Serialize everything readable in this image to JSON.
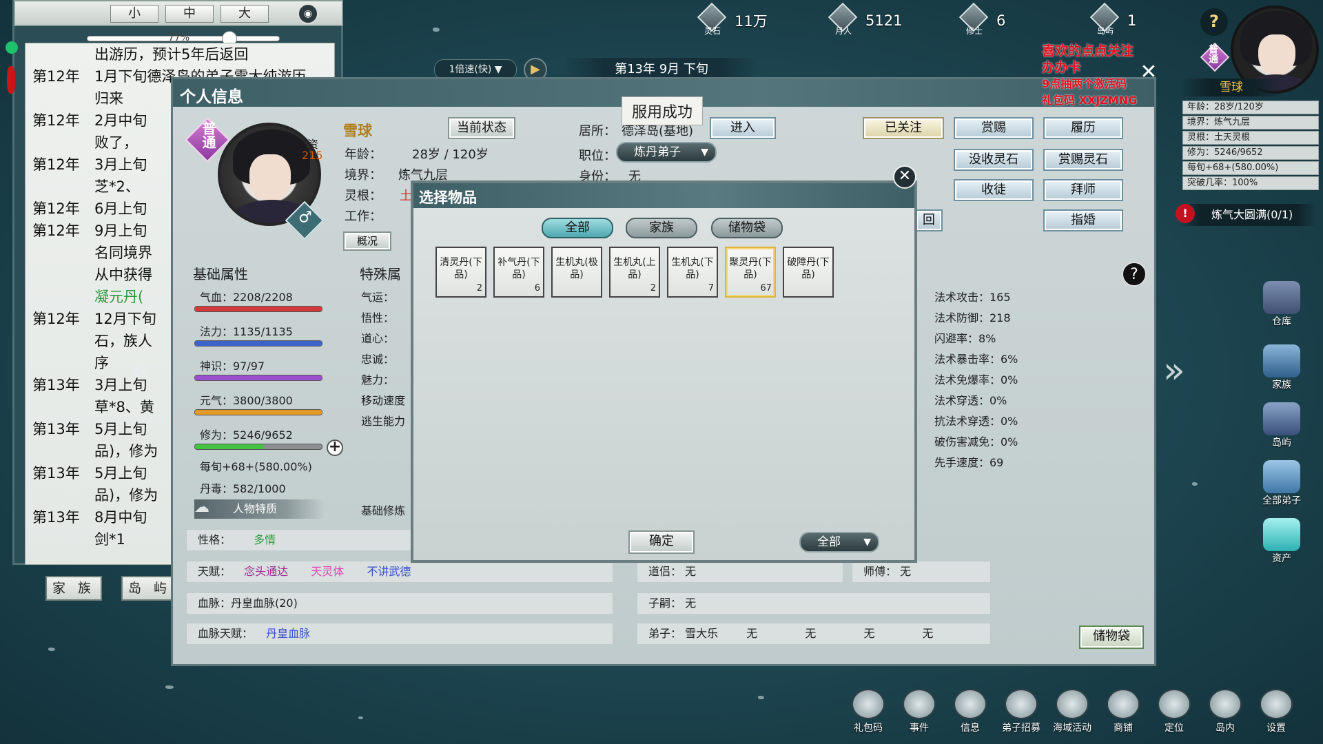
{
  "top_resources": [
    {
      "label": "灵石",
      "value": "11万"
    },
    {
      "label": "月人",
      "value": "5121"
    },
    {
      "label": "修士",
      "value": "6"
    },
    {
      "label": "岛屿",
      "value": "1"
    }
  ],
  "log": {
    "size_buttons": [
      "小",
      "中",
      "大"
    ],
    "zoom_pct": "77%",
    "entries": [
      {
        "year": "",
        "text": "出游历，预计5年后返回"
      },
      {
        "year": "第12年",
        "text": "1月下旬德泽岛的弟子雪大纯游历\n归来"
      },
      {
        "year": "第12年",
        "text": "2月中旬\n败了，"
      },
      {
        "year": "第12年",
        "text": "3月上旬\n芝*2、"
      },
      {
        "year": "第12年",
        "text": "6月上旬"
      },
      {
        "year": "第12年",
        "text": "9月上旬\n名同境界\n从中获得"
      },
      {
        "year": "",
        "text": "凝元丹(",
        "green": true
      },
      {
        "year": "第12年",
        "text": "12月下旬\n石，族人\n序"
      },
      {
        "year": "第13年",
        "text": "3月上旬\n草*8、黄"
      },
      {
        "year": "第13年",
        "text": "5月上旬\n品)，修为"
      },
      {
        "year": "第13年",
        "text": "5月上旬\n品)，修为"
      },
      {
        "year": "第13年",
        "text": "8月中旬\n剑*1"
      }
    ],
    "tabs": [
      "家 族",
      "岛 屿"
    ]
  },
  "speed_label": "1倍速(快)",
  "date_label": "第13年 9月 下旬",
  "main": {
    "title": "个人信息",
    "toast": "服用成功",
    "grade": "普通",
    "zi_label": "资",
    "zi_value": "215",
    "name": "雪球",
    "fields": {
      "age_label": "年龄：",
      "age_value": "28岁 / 120岁",
      "realm_label": "境界：",
      "realm_value": "炼气九层",
      "root_label": "灵根：",
      "root_value": "土",
      "work_label": "工作："
    },
    "current_state_btn": "当前状态",
    "residence_label": "居所：",
    "residence_value": "德泽岛(基地)",
    "enter_btn": "进入",
    "position_label": "职位：",
    "position_value": "炼丹弟子",
    "identity_label": "身份：",
    "identity_value": "无",
    "overview_tab": "概况",
    "return_btn": "回",
    "action_buttons": [
      "已关注",
      "赏赐",
      "履历",
      "没收灵石",
      "赏赐灵石",
      "收徒",
      "拜师",
      "指婚"
    ],
    "basic_attr_title": "基础属性",
    "special_attr_title": "特殊属",
    "basic_cultivation_title": "基础修炼",
    "stats": [
      {
        "label": "气血：2208/2208",
        "fill": 1.0,
        "color": "#d23a3a"
      },
      {
        "label": "法力：1135/1135",
        "fill": 1.0,
        "color": "#3c63c9"
      },
      {
        "label": "神识：97/97",
        "fill": 1.0,
        "color": "#9a4fd1"
      },
      {
        "label": "元气：3800/3800",
        "fill": 1.0,
        "color": "#e59a28"
      },
      {
        "label": "修为：5246/9652",
        "fill": 0.5435,
        "color": "#43c33f"
      }
    ],
    "per_xun": "每旬+68+(580.00%)",
    "dan_du": "丹毒：582/1000",
    "trait_btn": "人物特质",
    "special_labels": [
      "气运：",
      "悟性：",
      "道心：",
      "忠诚：",
      "魅力：",
      "移动速度",
      "逃生能力"
    ],
    "right_stats": [
      "法术攻击：165",
      "法术防御：218",
      "闪避率：8%",
      "法术暴击率：6%",
      "法术免爆率：0%",
      "法术穿透：0%",
      "抗法术穿透：0%",
      "破伤害减免：0%",
      "先手速度：69"
    ],
    "rows": {
      "personality_label": "性格：",
      "personality_value": "多情",
      "talent_label": "天赋：",
      "talents": [
        "念头通达",
        "天灵体",
        "不讲武德"
      ],
      "bloodline_label": "血脉：丹皇血脉(20)",
      "bloodline_talent_label": "血脉天赋：",
      "bloodline_talent_value": "丹皇血脉",
      "daolv_label": "道侣：",
      "daolv_value": "无",
      "master_label": "师傅：",
      "master_value": "无",
      "heir_label": "子嗣：",
      "heir_value": "无",
      "disciple_label": "弟子：",
      "disciples": [
        "雪大乐",
        "无",
        "无",
        "无",
        "无"
      ]
    },
    "storage_bag_btn": "储物袋"
  },
  "dialog": {
    "title": "选择物品",
    "tabs": [
      "全部",
      "家族",
      "储物袋"
    ],
    "items": [
      {
        "name": "清灵丹(下品)",
        "count": "2"
      },
      {
        "name": "补气丹(下品)",
        "count": "6"
      },
      {
        "name": "生机丸(极品)",
        "count": ""
      },
      {
        "name": "生机丸(上品)",
        "count": "2"
      },
      {
        "name": "生机丸(下品)",
        "count": "7"
      },
      {
        "name": "聚灵丹(下品)",
        "count": "67",
        "selected": true
      },
      {
        "name": "破障丹(下品)",
        "count": ""
      }
    ],
    "confirm_btn": "确定",
    "filter_value": "全部"
  },
  "right_panel": {
    "red_note": [
      "喜欢的点点关注",
      "办办卡",
      "9点抽两个激活码",
      "礼包码 XXJZMNG"
    ],
    "grade": "普通",
    "name": "雪球",
    "mini_rows": [
      "年龄：28岁/120岁",
      "境界：炼气九层",
      "灵根：土天灵根",
      "修为：5246/9652",
      "每旬+68+(580.00%)",
      "突破几率：100%"
    ],
    "quest": "炼气大圆满(0/1)",
    "side_icons": [
      "仓库",
      "家族",
      "岛屿",
      "全部弟子",
      "资产"
    ]
  },
  "bottom_icons": [
    "礼包码",
    "事件",
    "信息",
    "弟子招募",
    "海域活动",
    "商铺",
    "定位",
    "岛内",
    "设置"
  ]
}
